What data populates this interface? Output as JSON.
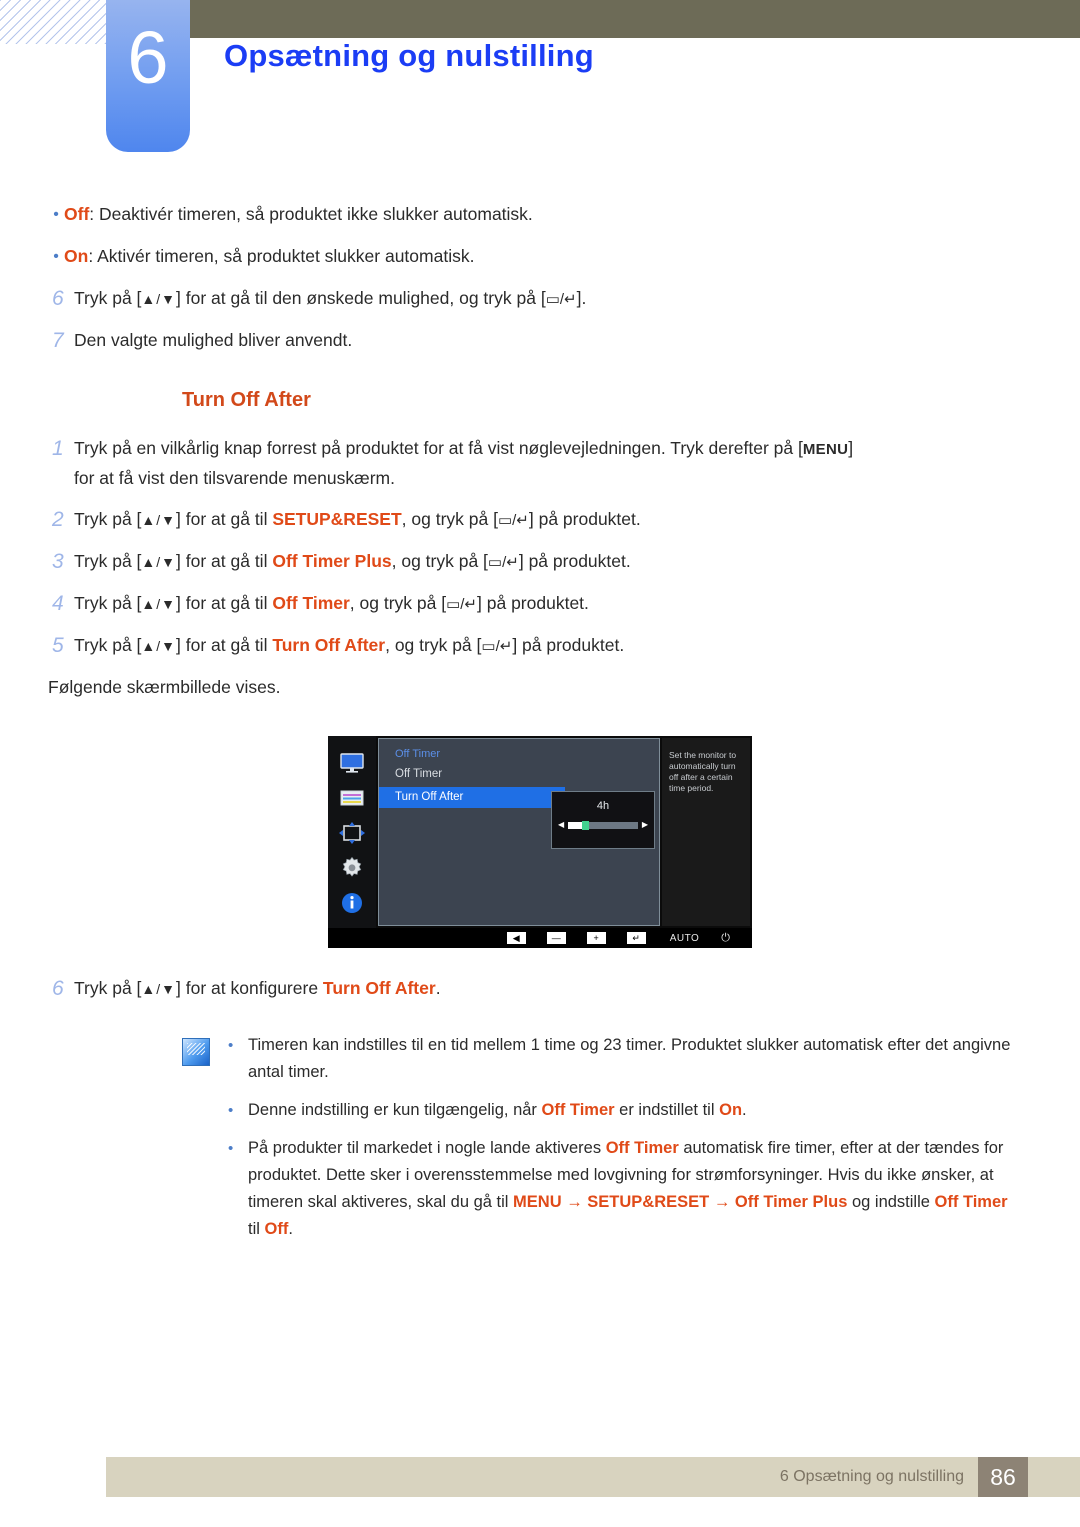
{
  "header": {
    "chapter_number": "6",
    "chapter_title": "Opsætning og nulstilling"
  },
  "intro_bullets": [
    {
      "term": "Off",
      "rest": ": Deaktivér timeren, så produktet ikke slukker automatisk."
    },
    {
      "term": "On",
      "rest": ": Aktivér timeren, så produktet slukker automatisk."
    }
  ],
  "intro_steps": [
    {
      "num": "6",
      "pre": "Tryk på [",
      "key1": "▲/▼",
      "mid": "] for at gå til den ønskede mulighed, og tryk på [",
      "key2": "▭/↵",
      "post": "]."
    },
    {
      "num": "7",
      "text": "Den valgte mulighed bliver anvendt."
    }
  ],
  "section": {
    "heading": "Turn Off After"
  },
  "steps": [
    {
      "num": "1",
      "line1_a": "Tryk på en vilkårlig knap forrest på produktet for at få vist nøglevejledningen. Tryk derefter på [",
      "menu_key": "MENU",
      "line1_b": "]",
      "line2": "for at få vist den tilsvarende menuskærm."
    },
    {
      "num": "2",
      "a": "Tryk på [",
      "key1": "▲/▼",
      "b": "] for at gå til ",
      "target": "SETUP&RESET",
      "c": ", og tryk på [",
      "key2": "▭/↵",
      "d": "] på produktet."
    },
    {
      "num": "3",
      "a": "Tryk på [",
      "key1": "▲/▼",
      "b": "] for at gå til ",
      "target": "Off Timer Plus",
      "c": ", og tryk på [",
      "key2": "▭/↵",
      "d": "] på produktet."
    },
    {
      "num": "4",
      "a": "Tryk på [",
      "key1": "▲/▼",
      "b": "] for at gå til ",
      "target": "Off Timer",
      "c": ", og tryk på [",
      "key2": "▭/↵",
      "d": "] på produktet."
    },
    {
      "num": "5",
      "a": "Tryk på [",
      "key1": "▲/▼",
      "b": "] for at gå til ",
      "target": "Turn Off After",
      "c": ", og tryk på [",
      "key2": "▭/↵",
      "d": "] på produktet.",
      "followup": "Følgende skærmbillede vises."
    }
  ],
  "osd": {
    "title": "Off Timer",
    "menu_items": [
      {
        "label": "Off Timer",
        "selected": false
      },
      {
        "label": "Turn Off After",
        "selected": true
      }
    ],
    "value": "4h",
    "slider": {
      "min_label": "◀",
      "max_label": "▶",
      "percent": 20
    },
    "help_text": "Set the monitor to automatically turn off after a certain time period.",
    "icons": [
      "display-icon",
      "color-bars-icon",
      "size-position-icon",
      "gear-icon",
      "info-icon"
    ],
    "buttons": [
      {
        "name": "back-key",
        "glyph": "◀"
      },
      {
        "name": "minus-key",
        "glyph": "—"
      },
      {
        "name": "plus-key",
        "glyph": "+"
      },
      {
        "name": "enter-key",
        "glyph": "↵"
      }
    ],
    "auto_label": "AUTO",
    "power_glyph": "⏻"
  },
  "step_after_osd": {
    "num": "6",
    "a": "Tryk på [",
    "key1": "▲/▼",
    "b": "] for at konfigurere ",
    "target": "Turn Off After",
    "c": "."
  },
  "notes": [
    {
      "text": "Timeren kan indstilles til en tid mellem 1 time og 23 timer. Produktet slukker automatisk efter det angivne antal timer."
    },
    {
      "a": "Denne indstilling er kun tilgængelig, når ",
      "t1": "Off Timer",
      "b": " er indstillet til ",
      "t2": "On",
      "c": "."
    },
    {
      "a": "På produkter til markedet i nogle lande aktiveres ",
      "t1": "Off Timer",
      "b": " automatisk fire timer, efter at der tændes for produktet. Dette sker i overensstemmelse med lovgivning for strømforsyninger. Hvis du ikke ønsker, at timeren skal aktiveres, skal du gå til ",
      "t2": "MENU",
      "arrow1": " → ",
      "t3": "SETUP&RESET",
      "arrow2": " → ",
      "t4": "Off Timer Plus",
      "c": " og indstille ",
      "t5": "Off Timer",
      "d": " til ",
      "t6": "Off",
      "e": "."
    }
  ],
  "footer": {
    "text": "6 Opsætning og nulstilling",
    "page": "86"
  },
  "colors": {
    "accent_orange": "#e04a18",
    "heading_orange": "#d2491a",
    "chapter_blue": "#1b3df5",
    "tab_blue": "#6f9cf0",
    "olive": "#6d6b57",
    "footer_beige": "#d8d3bf",
    "footer_page_bg": "#8d8375"
  }
}
